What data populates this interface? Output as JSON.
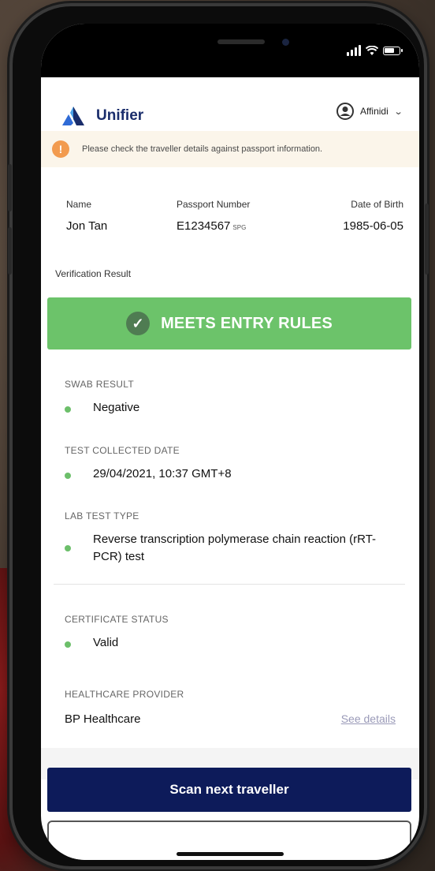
{
  "app": {
    "brand": "Unifier",
    "account_name": "Affinidi"
  },
  "notice": {
    "icon": "!",
    "text": "Please check the traveller details against passport information."
  },
  "traveller": {
    "name_label": "Name",
    "name_value": "Jon Tan",
    "passport_label": "Passport Number",
    "passport_value": "E1234567",
    "passport_country": "SPG",
    "dob_label": "Date of Birth",
    "dob_value": "1985-06-05"
  },
  "verification": {
    "label": "Verification Result",
    "result": "MEETS ENTRY RULES",
    "result_color": "#6cc36a"
  },
  "fields": [
    {
      "label": "SWAB RESULT",
      "value": "Negative"
    },
    {
      "label": "TEST COLLECTED DATE",
      "value": "29/04/2021, 10:37 GMT+8"
    },
    {
      "label": "LAB TEST TYPE",
      "value": "Reverse transcription polymerase chain reaction (rRT-PCR) test"
    },
    {
      "label": "CERTIFICATE STATUS",
      "value": "Valid"
    }
  ],
  "provider": {
    "label": "HEALTHCARE PROVIDER",
    "name": "BP Healthcare",
    "link": "See details"
  },
  "actions": {
    "scan_next": "Scan next traveller"
  },
  "colors": {
    "brand_navy": "#0d1b5a",
    "status_dot": "#6cbf6a",
    "notice_orange": "#f29b4f"
  }
}
